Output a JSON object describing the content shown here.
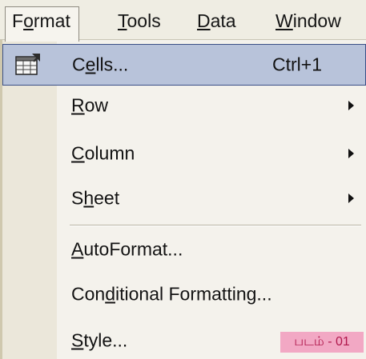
{
  "menubar": {
    "items": [
      {
        "pre": "F",
        "ul": "o",
        "post": "rmat"
      },
      {
        "pre": "",
        "ul": "T",
        "post": "ools"
      },
      {
        "pre": "",
        "ul": "D",
        "post": "ata"
      },
      {
        "pre": "",
        "ul": "W",
        "post": "indow"
      }
    ]
  },
  "menu": {
    "items": [
      {
        "pre": "C",
        "ul": "e",
        "post": "lls...",
        "shortcut": "Ctrl+1",
        "icon": "format-cells-icon"
      },
      {
        "pre": "",
        "ul": "R",
        "post": "ow"
      },
      {
        "pre": "",
        "ul": "C",
        "post": "olumn"
      },
      {
        "pre": "S",
        "ul": "h",
        "post": "eet"
      },
      {
        "pre": "",
        "ul": "A",
        "post": "utoFormat..."
      },
      {
        "pre": "Con",
        "ul": "d",
        "post": "itional Formatting..."
      },
      {
        "pre": "",
        "ul": "S",
        "post": "tyle..."
      }
    ]
  },
  "figure_label": "படம் - 01",
  "colors": {
    "highlight": "#b8c3da",
    "highlight_border": "#3a4f86",
    "menubar_bg": "#efede3",
    "figure_label_bg": "#f2a8c4",
    "figure_label_text": "#b0184c"
  }
}
